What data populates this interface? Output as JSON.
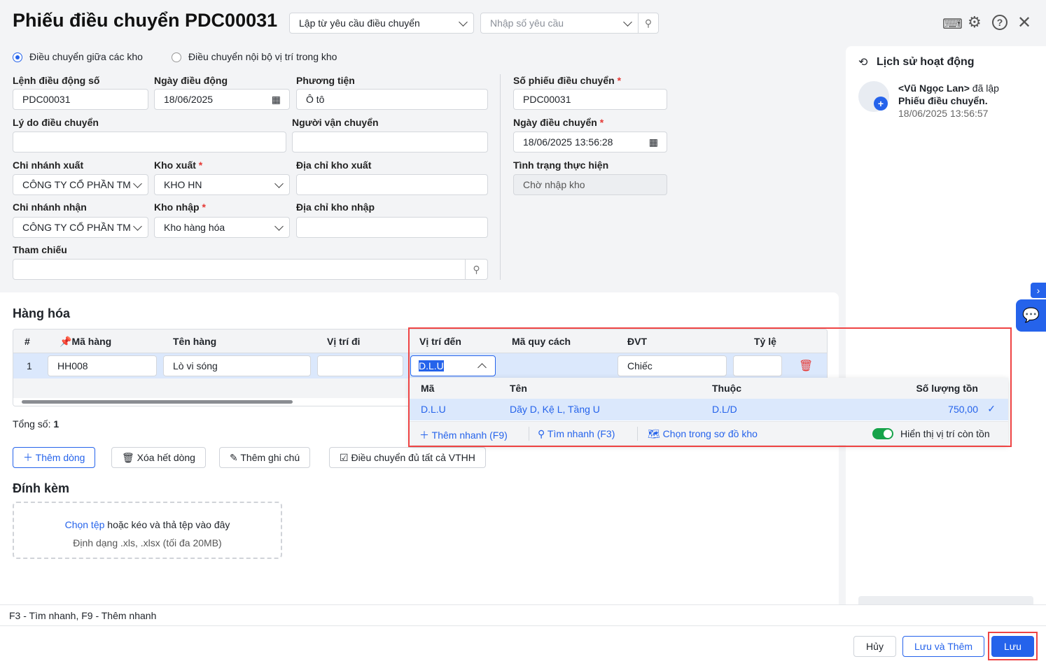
{
  "header": {
    "title": "Phiếu điều chuyển PDC00031",
    "source_select": "Lập từ yêu cầu điều chuyển",
    "request_placeholder": "Nhập số yêu cầu"
  },
  "mode": {
    "option1": "Điều chuyển giữa các kho",
    "option2": "Điều chuyển nội bộ vị trí trong kho",
    "selected": "option1"
  },
  "form": {
    "order_no_label": "Lệnh điều động số",
    "order_no": "PDC00031",
    "order_date_label": "Ngày điều động",
    "order_date": "18/06/2025",
    "vehicle_label": "Phương tiện",
    "vehicle": "Ô tô",
    "reason_label": "Lý do điều chuyển",
    "reason": "",
    "carrier_label": "Người vận chuyển",
    "carrier": "",
    "from_branch_label": "Chi nhánh xuất",
    "from_branch": "CÔNG TY CỔ PHẦN TM",
    "from_wh_label": "Kho xuất",
    "from_wh": "KHO HN",
    "from_addr_label": "Địa chỉ kho xuất",
    "to_branch_label": "Chi nhánh nhận",
    "to_branch": "CÔNG TY CỔ PHẦN TM",
    "to_wh_label": "Kho nhập",
    "to_wh": "Kho hàng hóa",
    "to_addr_label": "Địa chỉ kho nhập",
    "ref_label": "Tham chiếu",
    "slip_no_label": "Số phiếu điều chuyển",
    "slip_no": "PDC00031",
    "slip_date_label": "Ngày điều chuyển",
    "slip_date": "18/06/2025 13:56:28",
    "status_label": "Tình trạng thực hiện",
    "status": "Chờ nhập kho",
    "required_mark": "*"
  },
  "goods": {
    "title": "Hàng hóa",
    "columns": [
      "#",
      "Mã hàng",
      "Tên hàng",
      "Vị trí đi",
      "Vị trí đến",
      "Mã quy cách",
      "ĐVT",
      "Tỷ lệ c"
    ],
    "rows": [
      {
        "no": "1",
        "code": "HH008",
        "name": "Lò vi sóng",
        "from_loc": "",
        "to_loc": "D.L.U",
        "spec": "",
        "unit": "Chiếc",
        "ratio": ""
      }
    ],
    "total_label": "Tổng số:",
    "total": "1",
    "buttons": {
      "add_row": "Thêm dòng",
      "clear_rows": "Xóa hết dòng",
      "add_note": "Thêm ghi chú",
      "transfer_all": "Điều chuyển đủ tất cả VTHH"
    }
  },
  "dropdown": {
    "columns": [
      "Mã",
      "Tên",
      "Thuộc",
      "Số lượng tồn"
    ],
    "items": [
      {
        "code": "D.L.U",
        "name": "Dãy D, Kệ L, Tầng U",
        "parent": "D.L/D",
        "qty": "750,00"
      }
    ],
    "quick_add": "Thêm nhanh (F9)",
    "quick_find": "Tìm nhanh (F3)",
    "choose_map": "Chọn trong sơ đồ kho",
    "show_stock": "Hiển thị vị trí còn tồn",
    "show_stock_on": true
  },
  "attach": {
    "title": "Đính kèm",
    "choose": "Chọn tệp",
    "drop": " hoặc kéo và thả tệp vào đây",
    "format": "Định dạng .xls, .xlsx (tối đa 20MB)"
  },
  "history": {
    "title": "Lịch sử hoạt động",
    "user": "<Vũ Ngọc Lan>",
    "action": " đã lập",
    "object": "Phiếu điều chuyển.",
    "time": "18/06/2025 13:56:57"
  },
  "hint": "F3 - Tìm nhanh, F9 - Thêm nhanh",
  "footer": {
    "cancel": "Hủy",
    "save_add": "Lưu và Thêm",
    "save": "Lưu"
  },
  "colors": {
    "accent": "#2563eb",
    "highlight": "#ef4444",
    "toggle": "#16a34a"
  }
}
